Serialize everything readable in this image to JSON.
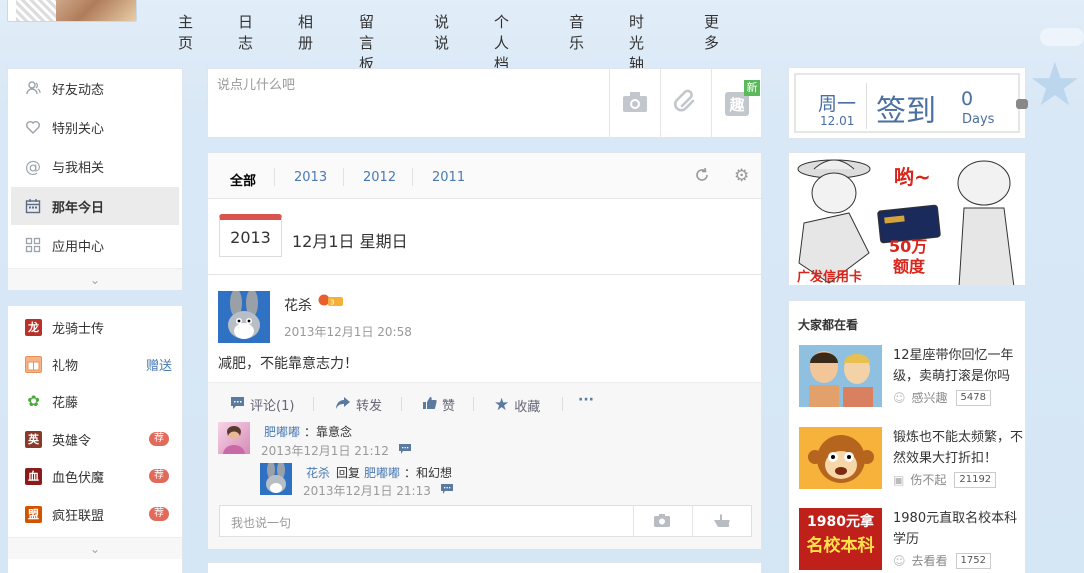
{
  "nav": {
    "items": [
      "主页",
      "日志",
      "相册",
      "留言板",
      "说说",
      "个人档",
      "音乐",
      "时光轴",
      "更多"
    ]
  },
  "left_menu": {
    "items": [
      {
        "label": "好友动态",
        "icon": "friends-icon"
      },
      {
        "label": "特别关心",
        "icon": "heart-icon"
      },
      {
        "label": "与我相关",
        "icon": "at-icon"
      },
      {
        "label": "那年今日",
        "icon": "calendar-icon",
        "active": true
      },
      {
        "label": "应用中心",
        "icon": "apps-grid-icon"
      }
    ]
  },
  "apps": {
    "items": [
      {
        "label": "龙骑士传",
        "color": "#b8322a",
        "glyph": "龙"
      },
      {
        "label": "礼物",
        "color": "#e8925a",
        "glyph": "礼",
        "link": "赠送"
      },
      {
        "label": "花藤",
        "color": "#4aa83a",
        "glyph": "藤"
      },
      {
        "label": "英雄令",
        "color": "#c0392b",
        "glyph": "英",
        "badge": "荐"
      },
      {
        "label": "血色伏魔",
        "color": "#8b1a1a",
        "glyph": "血",
        "badge": "荐"
      },
      {
        "label": "疯狂联盟",
        "color": "#d35400",
        "glyph": "盟",
        "badge": "荐"
      }
    ]
  },
  "compose": {
    "placeholder": "说点儿什么吧",
    "new_badge": "新",
    "fun_label": "趣"
  },
  "tabs": {
    "items": [
      "全部",
      "2013",
      "2012",
      "2011"
    ]
  },
  "date_header": {
    "year": "2013",
    "date": "12月1日 星期日"
  },
  "post": {
    "author": "花杀",
    "time": "2013年12月1日 20:58",
    "text": "减肥，不能靠意志力！",
    "actions": {
      "comment": "评论(1)",
      "share": "转发",
      "like": "赞",
      "favorite": "收藏",
      "more": "···"
    },
    "comments": [
      {
        "author": "肥嘟嘟",
        "text": "：靠意念",
        "time": "2013年12月1日 21:12"
      }
    ],
    "reply": {
      "author": "花杀",
      "verb": "回复",
      "target": "肥嘟嘟",
      "text": "：和幻想",
      "time": "2013年12月1日 21:13"
    },
    "reply_placeholder": "我也说一句"
  },
  "signin": {
    "weekday": "周一",
    "date": "12.01",
    "label": "签到",
    "days": "0",
    "days_unit": "Days"
  },
  "ad": {
    "text_exclaim": "哟~",
    "text_amount": "50万",
    "text_limit": "额度",
    "brand": "广发信用卡"
  },
  "trending": {
    "title": "大家都在看",
    "items": [
      {
        "title": "12星座带你回忆一年级，卖萌打滚是你吗",
        "meta": "感兴趣",
        "count": "5478",
        "thumb_color": "#e8b070"
      },
      {
        "title": "锻炼也不能太频繁，不然效果大打折扣！",
        "meta": "伤不起",
        "count": "21192",
        "thumb_color": "#f0a030"
      },
      {
        "title": "1980元直取名校本科学历",
        "meta": "去看看",
        "count": "1752",
        "thumb_color": "#c0201a",
        "thumb_text1": "1980元拿",
        "thumb_text2": "名校本科"
      }
    ]
  }
}
